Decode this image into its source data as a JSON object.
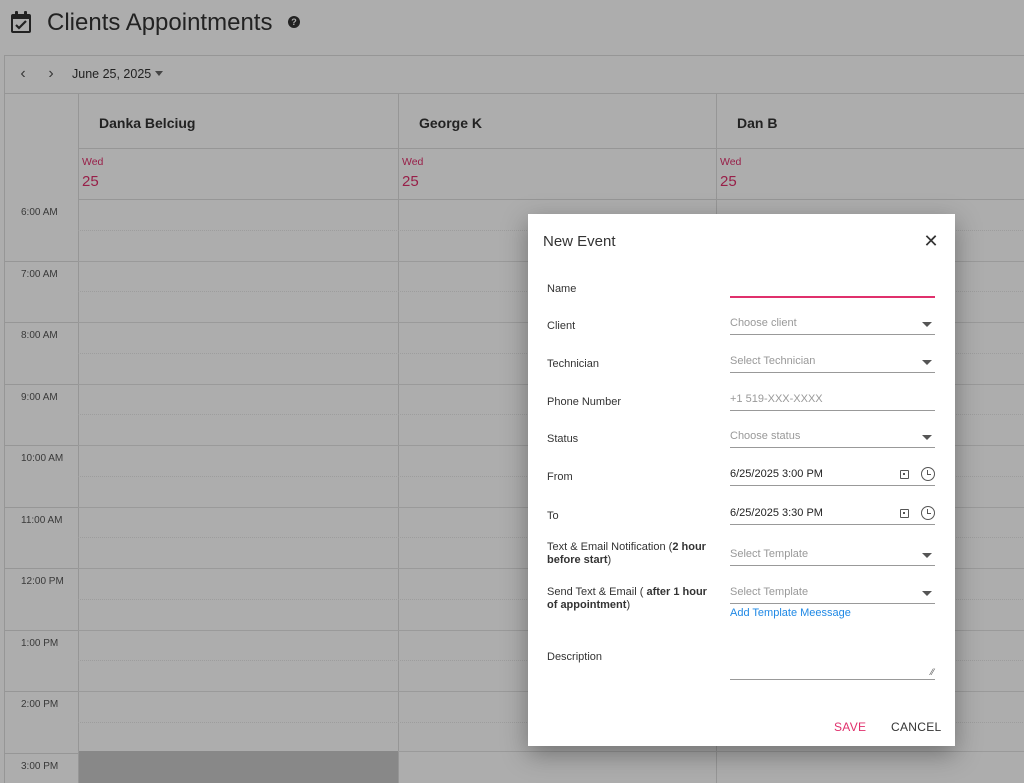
{
  "header": {
    "title": "Clients Appointments",
    "help": "?"
  },
  "toolbar": {
    "prev": "‹",
    "next": "›",
    "date": "June 25, 2025"
  },
  "resources": [
    {
      "name": "Danka Belciug",
      "dow": "Wed",
      "day": "25"
    },
    {
      "name": "George K",
      "dow": "Wed",
      "day": "25"
    },
    {
      "name": "Dan B",
      "dow": "Wed",
      "day": "25"
    }
  ],
  "times": [
    "6:00 AM",
    "7:00 AM",
    "8:00 AM",
    "9:00 AM",
    "10:00 AM",
    "11:00 AM",
    "12:00 PM",
    "1:00 PM",
    "2:00 PM",
    "3:00 PM"
  ],
  "dialog": {
    "title": "New Event",
    "close": "✕",
    "fields": {
      "name": {
        "label": "Name",
        "value": ""
      },
      "client": {
        "label": "Client",
        "placeholder": "Choose client"
      },
      "technician": {
        "label": "Technician",
        "placeholder": "Select Technician"
      },
      "phone": {
        "label": "Phone Number",
        "placeholder": "+1 519-XXX-XXXX"
      },
      "status": {
        "label": "Status",
        "placeholder": "Choose status"
      },
      "from": {
        "label": "From",
        "value": "6/25/2025 3:00 PM"
      },
      "to": {
        "label": "To",
        "value": "6/25/2025 3:30 PM"
      },
      "notify": {
        "label_pre": "Text & Email Notification (",
        "label_bold": "2 hour before start",
        "label_post": ")",
        "placeholder": "Select Template"
      },
      "followup": {
        "label_pre": "Send Text & Email ( ",
        "label_bold": "after 1 hour of appointment",
        "label_post": ")",
        "placeholder": "Select Template"
      },
      "description": {
        "label": "Description",
        "value": ""
      }
    },
    "add_template": "Add Template Meessage",
    "save": "SAVE",
    "cancel": "CANCEL"
  },
  "colors": {
    "accent": "#e0306c",
    "link": "#1e88e5"
  }
}
